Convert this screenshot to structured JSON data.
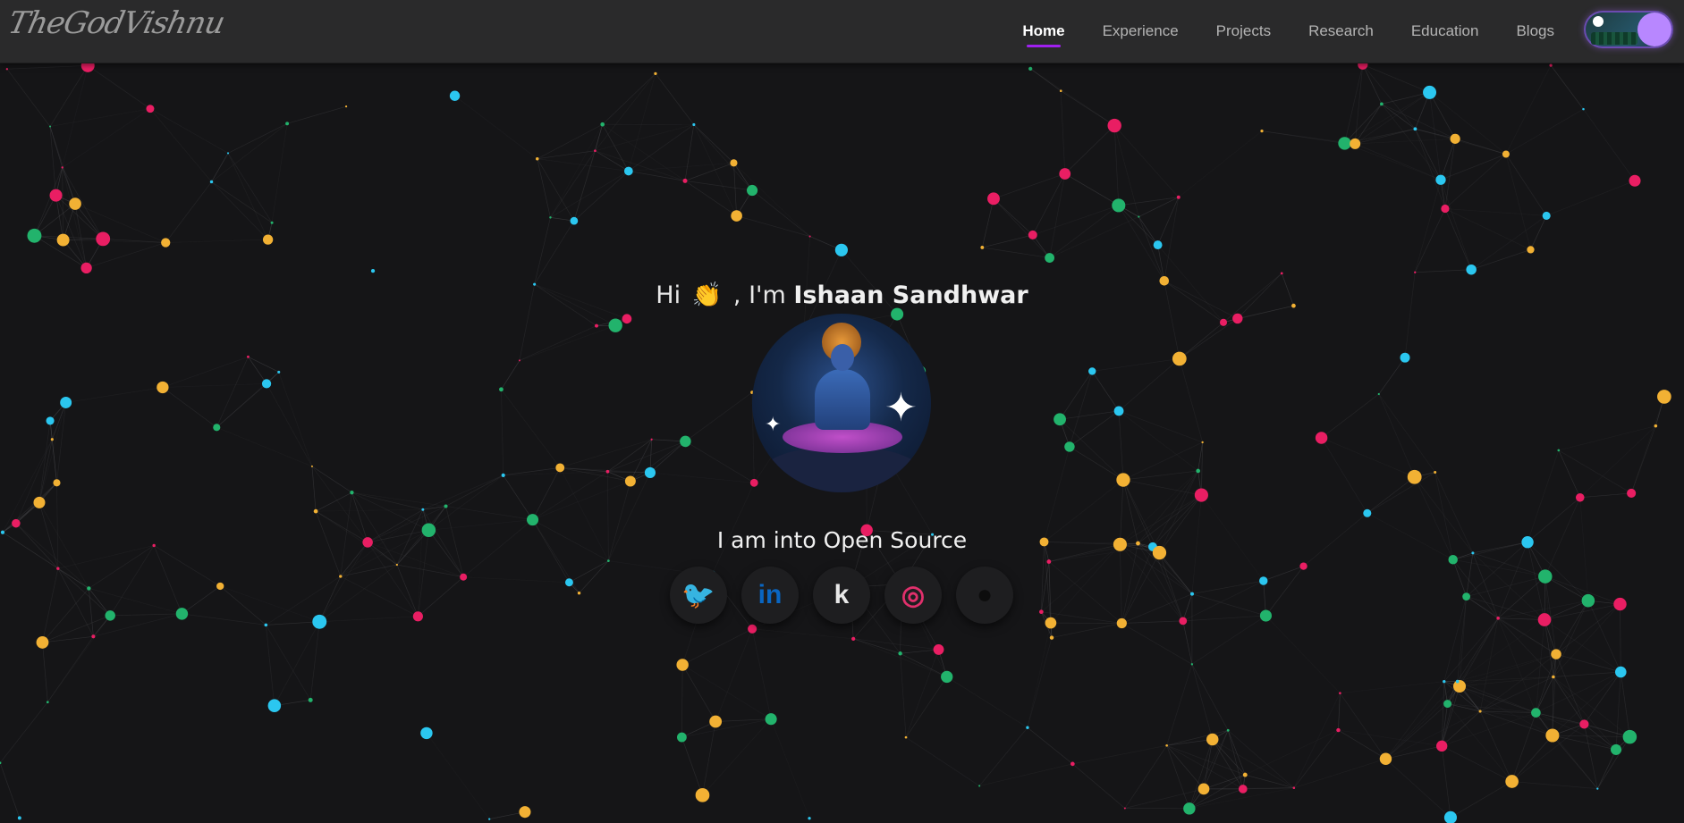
{
  "nav": {
    "logo": "TheGodVishnu",
    "links": [
      "Home",
      "Experience",
      "Projects",
      "Research",
      "Education",
      "Blogs"
    ],
    "active": "Home"
  },
  "hero": {
    "greeting_prefix": "Hi",
    "wave_emoji": "👏",
    "greeting_mid": ", I'm",
    "name": "Ishaan Sandhwar",
    "tagline": "I am into Open Source"
  },
  "socials": [
    {
      "name": "twitter-icon",
      "glyph": "🐦",
      "color": "#1d9bf0"
    },
    {
      "name": "linkedin-icon",
      "glyph": "in",
      "color": "#0a66c2"
    },
    {
      "name": "kaggle-icon",
      "glyph": "k",
      "color": "#e8e8e8"
    },
    {
      "name": "instagram-icon",
      "glyph": "◎",
      "color": "#e1306c"
    },
    {
      "name": "github-icon",
      "glyph": "●",
      "color": "#0d0d0d"
    }
  ],
  "colors": {
    "background": "#151517",
    "navbar": "#2a2a2b",
    "accent": "#a020f0",
    "node_colors": [
      "#e91e63",
      "#2bc7f0",
      "#22b36c",
      "#f2b134"
    ]
  }
}
